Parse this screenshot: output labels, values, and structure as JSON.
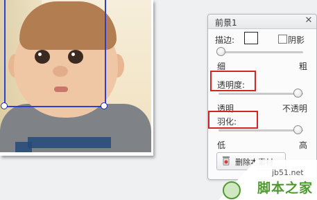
{
  "panel": {
    "title": "前景1",
    "close_icon": "close-icon",
    "stroke": {
      "label": "描边:",
      "shadow_label": "阴影",
      "shadow_checked": false,
      "min_label": "细",
      "max_label": "粗",
      "level": 0.0
    },
    "opacity": {
      "label": "透明度:",
      "min_label": "透明",
      "max_label": "不透明",
      "level": 1.0
    },
    "feather": {
      "label": "羽化:",
      "min_label": "低",
      "max_label": "高",
      "level": 1.0
    },
    "delete_button": {
      "label": "删除本素材",
      "icon": "trash-icon"
    }
  },
  "highlight_color": "#d32424",
  "selection_color": "#2d3fd1",
  "watermark": {
    "site": "jb51.net",
    "brand": "脚本之家"
  }
}
